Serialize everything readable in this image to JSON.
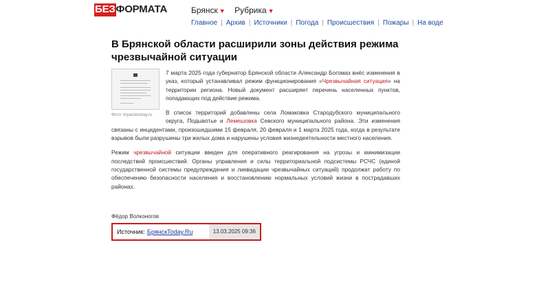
{
  "header": {
    "logo_part1": "БЕЗ",
    "logo_part2": "ФОРМАТА",
    "city_menu": "Брянск",
    "rubric_menu": "Рубрика"
  },
  "nav": [
    "Главное",
    "Архив",
    "Источники",
    "Погода",
    "Происшествия",
    "Пожары",
    "На воде"
  ],
  "article": {
    "title": "В Брянской области расширили зоны действия режима чрезвычайной ситуации",
    "photo_caption": "Фото: bryansktoday.ru",
    "p1_before": "7 марта 2025 года губернатор Брянской области Александр Богомаз внёс изменения в указ, который устанавливал режим функционирования «",
    "p1_highlight": "Чрезвычайная ситуация",
    "p1_after": "» на территории региона. Новый документ расширяет перечень населенных пунктов, попадающих под действие режима.",
    "p2_before": "В список территорий добавлены села Ломаковка Стародубского муниципального округа, Подывотье и ",
    "p2_highlight": "Лемешовка",
    "p2_after": " Севского муниципального района. Эти изменения связаны с инцидентами, произошедшими 15 февраля, 20 февраля и 1 марта 2025 года, когда в результате взрывов были разрушены три жилых дома и нарушены условия жизнедеятельности местного населения.",
    "p3_before": "Режим ",
    "p3_highlight": "чрезвычайной",
    "p3_after": " ситуации введен для оперативного реагирования на угрозы и минимизации последствий происшествий. Органы управления и силы территориальной подсистемы РСЧС (единой государственной системы предупреждения и ликвидации чрезвычайных ситуаций) продолжат работу по обеспечению безопасности населения и восстановлению нормальных условий жизни в пострадавших районах.",
    "author": "Фёдор Волконогов"
  },
  "source": {
    "label": "Источник:",
    "link": "БрянскToday.Ru",
    "datetime": "13.03.2025 09:36"
  },
  "colors": {
    "accent": "#d42020",
    "link": "#1a4aa0"
  }
}
